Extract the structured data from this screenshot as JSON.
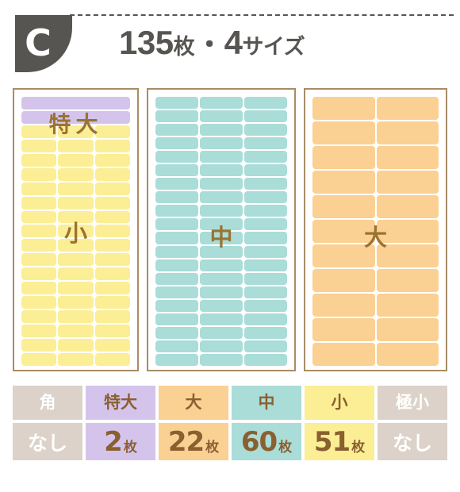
{
  "header": {
    "badge_letter": "C",
    "title_count": "135",
    "title_count_unit": "枚",
    "title_separator": "・",
    "title_sizes": "4",
    "title_sizes_unit": "サイズ"
  },
  "panels": [
    {
      "name": "panel-small",
      "blocks": [
        {
          "label": "特大",
          "color": "#d4c4ec",
          "columns": 1,
          "rows": 2,
          "swatch": "purple"
        },
        {
          "label": "小",
          "color": "#fbee95",
          "columns": 3,
          "rows": 17,
          "swatch": "yellow"
        }
      ]
    },
    {
      "name": "panel-medium",
      "blocks": [
        {
          "label": "中",
          "color": "#aadcd8",
          "columns": 3,
          "rows": 20,
          "swatch": "teal"
        }
      ]
    },
    {
      "name": "panel-large",
      "blocks": [
        {
          "label": "大",
          "color": "#fbd093",
          "columns": 2,
          "rows": 11,
          "swatch": "orange"
        }
      ]
    }
  ],
  "summary": {
    "columns": [
      {
        "head": "角",
        "value": "なし",
        "unit": "",
        "bg": "gray",
        "is_none": true,
        "head_color": "white",
        "value_color": "white"
      },
      {
        "head": "特大",
        "value": "2",
        "unit": "枚",
        "bg": "purple",
        "is_none": false,
        "head_color": "brown",
        "value_color": "brown"
      },
      {
        "head": "大",
        "value": "22",
        "unit": "枚",
        "bg": "orange",
        "is_none": false,
        "head_color": "brown",
        "value_color": "brown"
      },
      {
        "head": "中",
        "value": "60",
        "unit": "枚",
        "bg": "teal",
        "is_none": false,
        "head_color": "brown",
        "value_color": "brown"
      },
      {
        "head": "小",
        "value": "51",
        "unit": "枚",
        "bg": "yellow",
        "is_none": false,
        "head_color": "brown",
        "value_color": "brown"
      },
      {
        "head": "極小",
        "value": "なし",
        "unit": "",
        "bg": "gray",
        "is_none": true,
        "head_color": "white",
        "value_color": "white"
      }
    ]
  },
  "colors": {
    "badge": "#575552",
    "panel_border": "#a98c66",
    "label_text": "#9a7333",
    "table_text": "#8a6030",
    "purple": "#d4c4ec",
    "yellow": "#fbee95",
    "teal": "#aadcd8",
    "orange": "#fbd093",
    "gray": "#dcd2c9"
  }
}
